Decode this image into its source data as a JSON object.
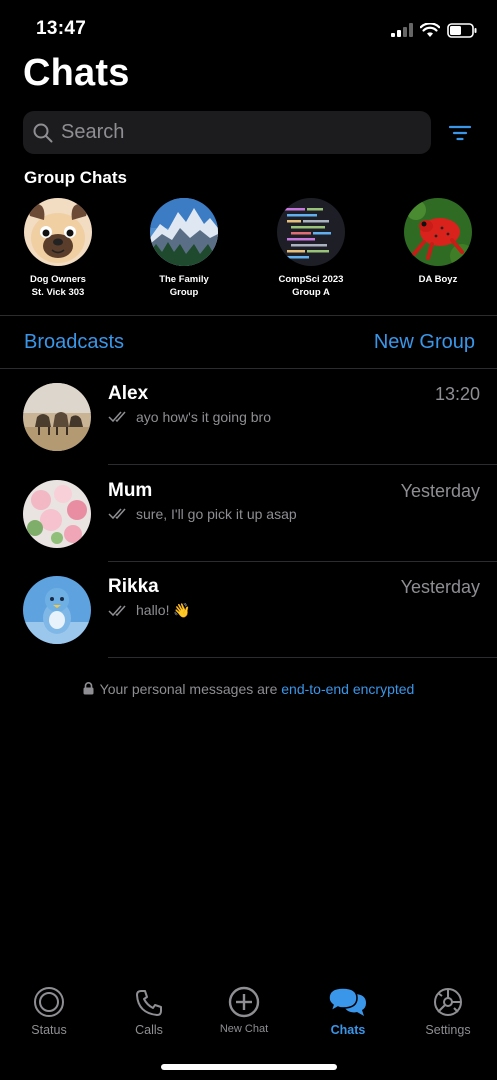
{
  "status_bar": {
    "time": "13:47"
  },
  "header": {
    "title": "Chats"
  },
  "search": {
    "placeholder": "Search"
  },
  "group_chats": {
    "title": "Group Chats",
    "items": [
      {
        "name": "Dog Owners\nSt. Vick 303",
        "avatar": "pug-cartoon"
      },
      {
        "name": "The Family\nGroup",
        "avatar": "mountain-photo"
      },
      {
        "name": "CompSci 2023\nGroup A",
        "avatar": "code-screenshot"
      },
      {
        "name": "DA Boyz",
        "avatar": "red-frog-photo"
      }
    ]
  },
  "links": {
    "broadcasts": "Broadcasts",
    "new_group": "New Group"
  },
  "chats": [
    {
      "name": "Alex",
      "time": "13:20",
      "message": "ayo how's it going bro",
      "avatar": "camels-photo",
      "status_icon": "double-check-icon"
    },
    {
      "name": "Mum",
      "time": "Yesterday",
      "message": "sure, I'll go pick it up asap",
      "avatar": "flowers-photo",
      "status_icon": "double-check-icon"
    },
    {
      "name": "Rikka",
      "time": "Yesterday",
      "message": "hallo! 👋",
      "avatar": "blue-figure-photo",
      "status_icon": "double-check-icon"
    }
  ],
  "encryption_note": {
    "text": "Your personal messages are ",
    "link": "end-to-end encrypted"
  },
  "tabs": [
    {
      "label": "Status",
      "icon": "status-icon"
    },
    {
      "label": "Calls",
      "icon": "phone-icon"
    },
    {
      "label": "New Chat",
      "icon": "plus-circle-icon"
    },
    {
      "label": "Chats",
      "icon": "chat-bubbles-icon",
      "active": true
    },
    {
      "label": "Settings",
      "icon": "gear-icon"
    }
  ],
  "colors": {
    "accent": "#3a96e8",
    "background": "#000000",
    "muted": "#8e8e93",
    "surface": "#1c1c1e"
  }
}
